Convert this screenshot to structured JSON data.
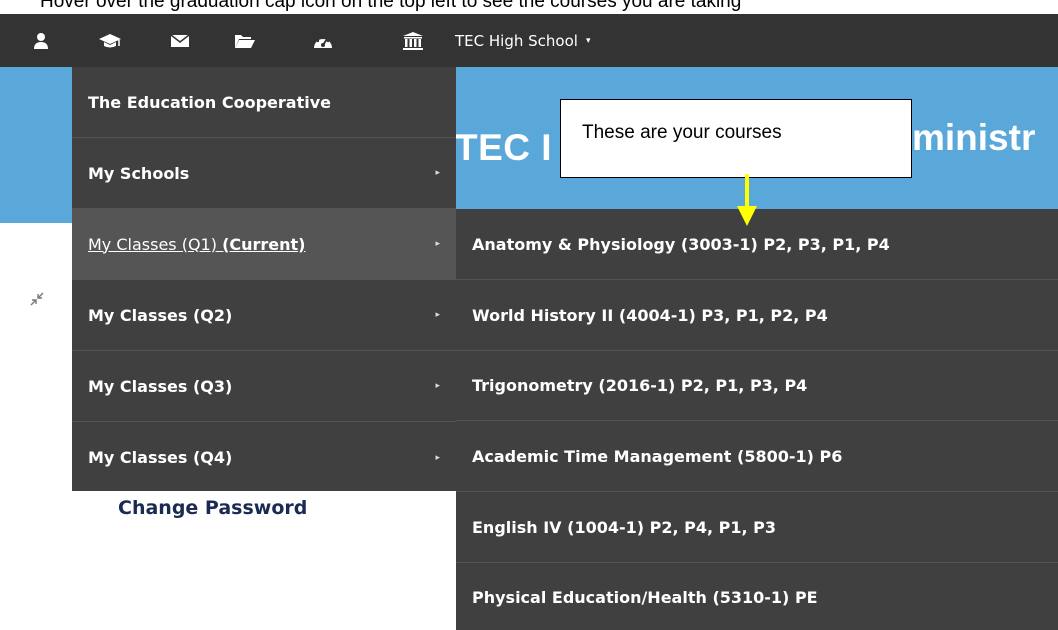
{
  "caption": "Hover over the graduation cap icon on the top left to see the courses you are taking",
  "nav": {
    "icons": [
      "user-icon",
      "graduation-cap-icon",
      "envelope-icon",
      "folder-open-icon",
      "dashboard-icon",
      "university-icon"
    ],
    "school_switch_label": "TEC High School",
    "school_switch_caret": "▾"
  },
  "banner": {
    "title_head": "TEC I",
    "title_tail": "ministr"
  },
  "callout": {
    "text": "These are your courses",
    "arrow_color": "#ffff00"
  },
  "menu": {
    "items": [
      {
        "label": "The Education Cooperative",
        "has_arrow": false
      },
      {
        "label": "My Schools",
        "has_arrow": true
      },
      {
        "label": "My Classes (Q1) ",
        "bold_suffix": "(Current)",
        "has_arrow": true,
        "active": true
      },
      {
        "label": "My Classes (Q2)",
        "has_arrow": true
      },
      {
        "label": "My Classes (Q3)",
        "has_arrow": true
      },
      {
        "label": "My Classes (Q4)",
        "has_arrow": true
      }
    ],
    "arrow_glyph": "▸"
  },
  "submenu": {
    "items": [
      "Anatomy & Physiology (3003-1) P2, P3, P1, P4",
      "World History II (4004-1) P3, P1, P2, P4",
      "Trigonometry (2016-1) P2, P1, P3, P4",
      "Academic Time Management (5800-1) P6",
      "English IV (1004-1) P2, P4, P1, P3",
      "Physical Education/Health (5310-1) PE"
    ]
  },
  "page": {
    "change_password": "Change Password"
  },
  "colors": {
    "navbar": "#333333",
    "menu_bg": "#404040",
    "menu_active": "#555555",
    "banner": "#5aa8da",
    "link": "#1a2a52"
  }
}
